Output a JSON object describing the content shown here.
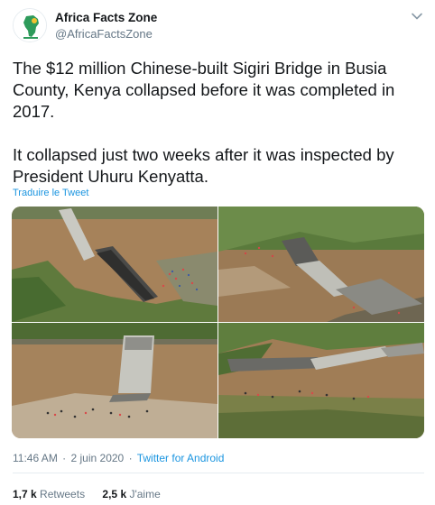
{
  "author": {
    "name": "Africa Facts Zone",
    "handle": "@AfricaFactsZone"
  },
  "tweet": {
    "paragraphs": [
      "The $12 million Chinese-built Sigiri Bridge in Busia County, Kenya collapsed before it was completed in 2017.",
      "It collapsed just two weeks after it was inspected by President Uhuru Kenyatta."
    ],
    "translate_label": "Traduire le Tweet"
  },
  "media": {
    "photo_count": 4
  },
  "meta": {
    "time": "11:46 AM",
    "date": "2 juin 2020",
    "separator": "·",
    "source": "Twitter for Android"
  },
  "stats": {
    "retweets_count": "1,7 k",
    "retweets_label": "Retweets",
    "likes_count": "2,5 k",
    "likes_label": "J'aime"
  },
  "colors": {
    "link": "#1b95e0",
    "secondary_text": "#657786",
    "primary_text": "#14171a",
    "river": "#9a7a55"
  }
}
